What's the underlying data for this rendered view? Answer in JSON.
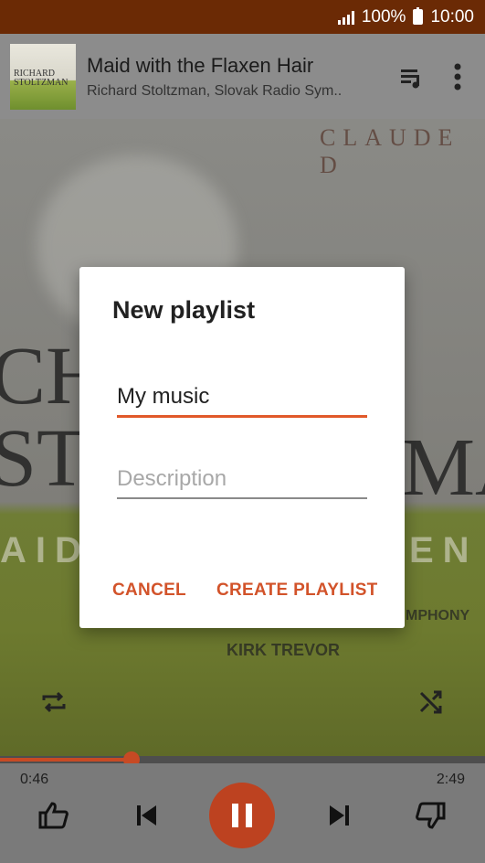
{
  "status_bar": {
    "battery": "100%",
    "time": "10:00"
  },
  "now_playing": {
    "album_thumb_text": "RICHARD STOLTZMAN",
    "title": "Maid with the Flaxen Hair",
    "artist": "Richard Stoltzman, Slovak Radio Sym..",
    "icons": [
      "queue-icon",
      "more-vert-icon"
    ]
  },
  "album_art": {
    "line1": "CLAUDE D",
    "line2": "CH",
    "line3": "ST",
    "line4": "MA",
    "line5": "AID",
    "line6": "EN",
    "line7": "MPHONY",
    "line8": "KIRK TREVOR"
  },
  "dialog": {
    "title": "New playlist",
    "name_value": "My music",
    "description_placeholder": "Description",
    "cancel_label": "CANCEL",
    "create_label": "CREATE PLAYLIST"
  },
  "playback": {
    "elapsed": "0:46",
    "duration": "2:49",
    "progress": 0.272
  },
  "colors": {
    "accent": "#d2532a",
    "status_bar": "#6b2a05",
    "play_button": "#bd4220"
  }
}
